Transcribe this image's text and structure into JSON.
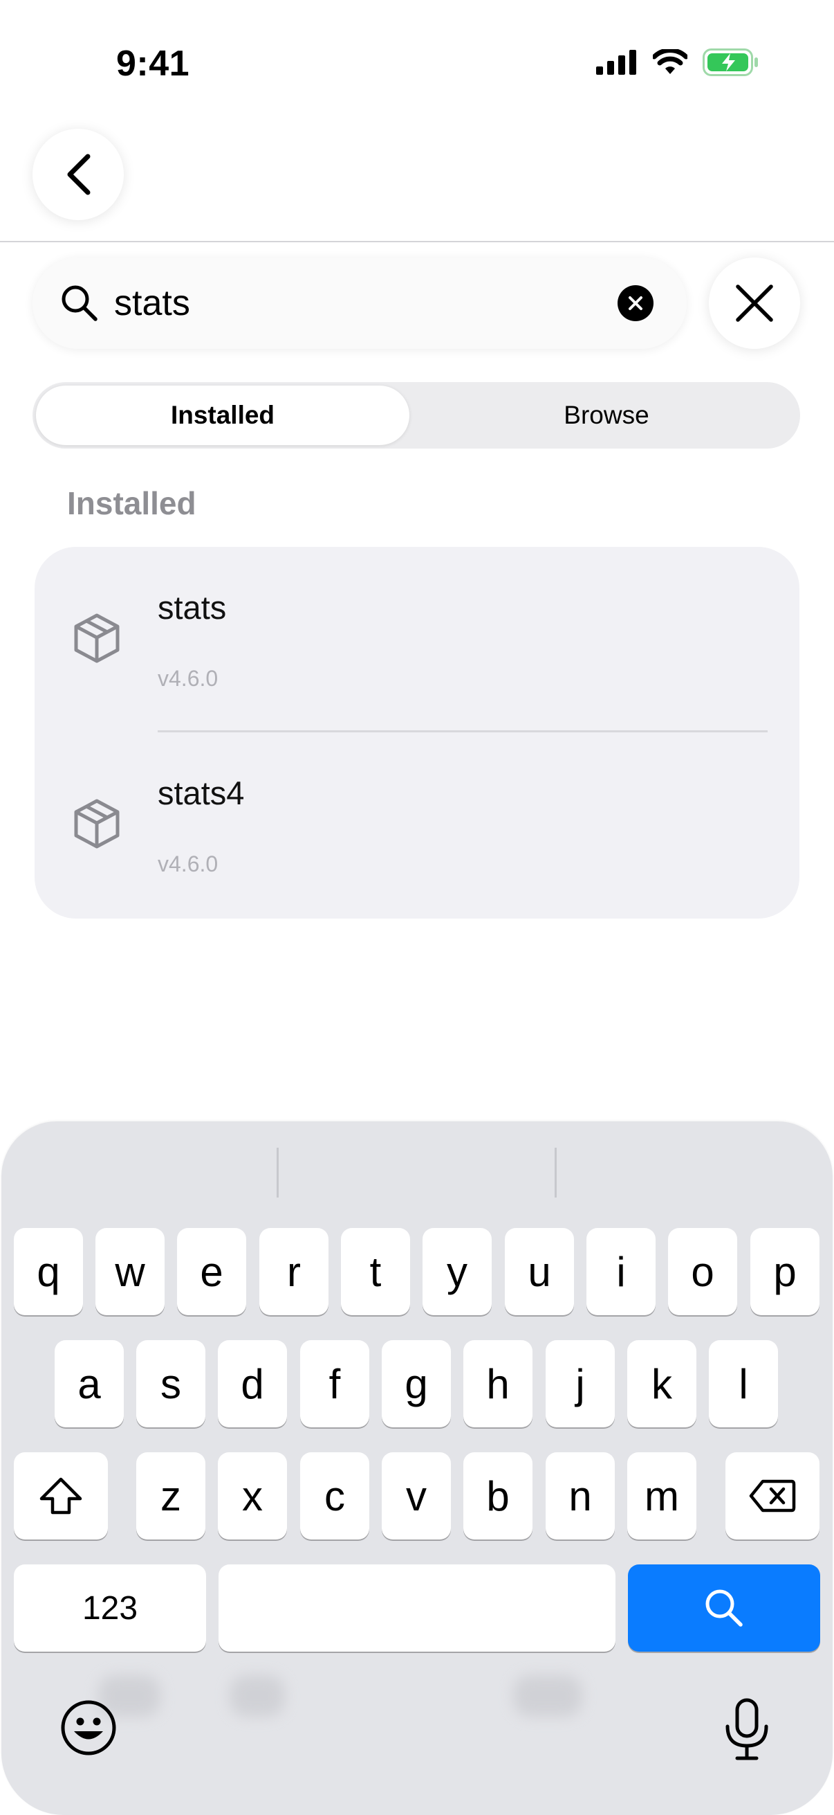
{
  "status_bar": {
    "time": "9:41"
  },
  "search": {
    "value": "stats"
  },
  "segmented": {
    "tabs": [
      "Installed",
      "Browse"
    ],
    "selected": "Installed"
  },
  "section": {
    "title": "Installed"
  },
  "packages": [
    {
      "name": "stats",
      "version": "v4.6.0"
    },
    {
      "name": "stats4",
      "version": "v4.6.0"
    }
  ],
  "keyboard": {
    "row1": [
      "q",
      "w",
      "e",
      "r",
      "t",
      "y",
      "u",
      "i",
      "o",
      "p"
    ],
    "row2": [
      "a",
      "s",
      "d",
      "f",
      "g",
      "h",
      "j",
      "k",
      "l"
    ],
    "row3": [
      "z",
      "x",
      "c",
      "v",
      "b",
      "n",
      "m"
    ],
    "numbers_key": "123",
    "search_key_color": "#0a7cff"
  },
  "colors": {
    "battery": "#34c759",
    "accent": "#0a7cff",
    "muted": "#8e8e93"
  },
  "icons": [
    "back-chevron-icon",
    "search-icon",
    "clear-icon",
    "close-icon",
    "package-icon",
    "shift-icon",
    "delete-icon",
    "emoji-icon",
    "microphone-icon"
  ]
}
